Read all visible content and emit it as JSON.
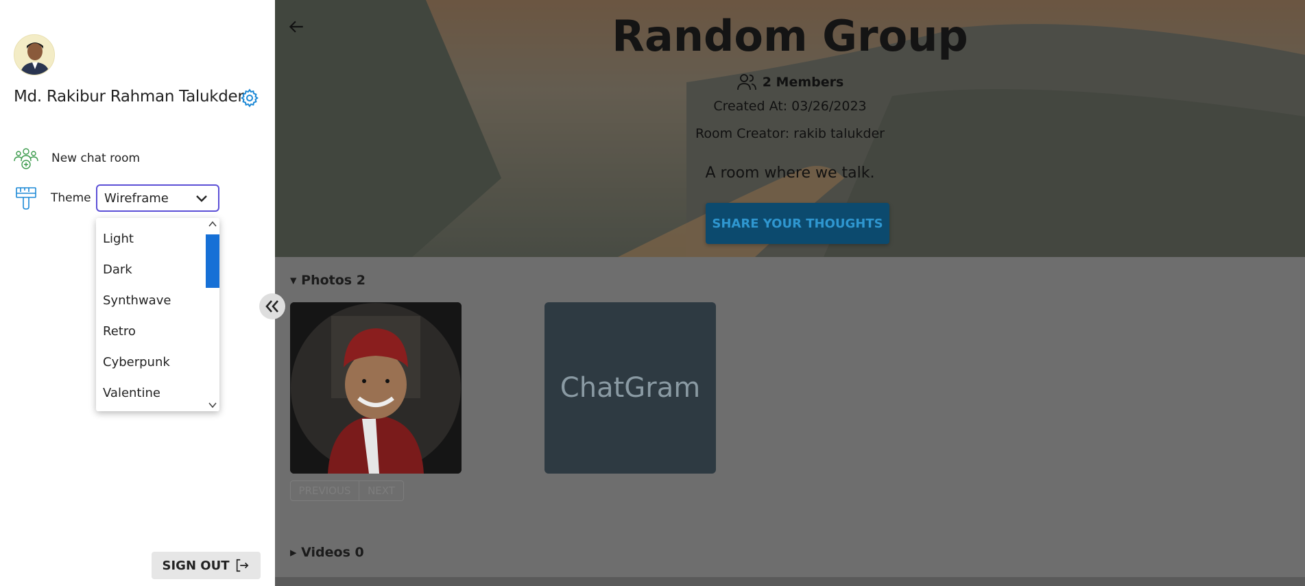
{
  "sidebar": {
    "user_name": "Md. Rakibur Rahman Talukder",
    "new_room_label": "New chat room",
    "theme_label": "Theme",
    "theme_selected": "Wireframe",
    "theme_options": [
      "Light",
      "Dark",
      "Synthwave",
      "Retro",
      "Cyberpunk",
      "Valentine"
    ],
    "sign_out_label": "SIGN OUT"
  },
  "room": {
    "title": "Random Group",
    "members": "2 Members",
    "created_at": "Created At: 03/26/2023",
    "creator": "Room Creator: rakib talukder",
    "description": "A room where we talk.",
    "share_label": "SHARE YOUR THOUGHTS"
  },
  "photos": {
    "summary": "Photos 2",
    "placeholder_text": "ChatGram",
    "prev_label": "PREVIOUS",
    "next_label": "NEXT"
  },
  "videos": {
    "summary": "Videos 0"
  },
  "icons": {
    "settings": "gear-icon",
    "new_room": "group-add-icon",
    "theme": "paint-brush-icon",
    "collapse": "double-chevron-left-icon",
    "sign_out": "logout-icon",
    "back": "arrow-left-icon",
    "members": "users-icon"
  },
  "colors": {
    "accent_select_border": "#5b4fd6",
    "scroll_thumb": "#1670d6",
    "icon_green": "#3a9a4b",
    "icon_blue": "#1b88d6",
    "share_button_bg": "#0c4a6e",
    "share_button_text": "#2f97d0"
  }
}
